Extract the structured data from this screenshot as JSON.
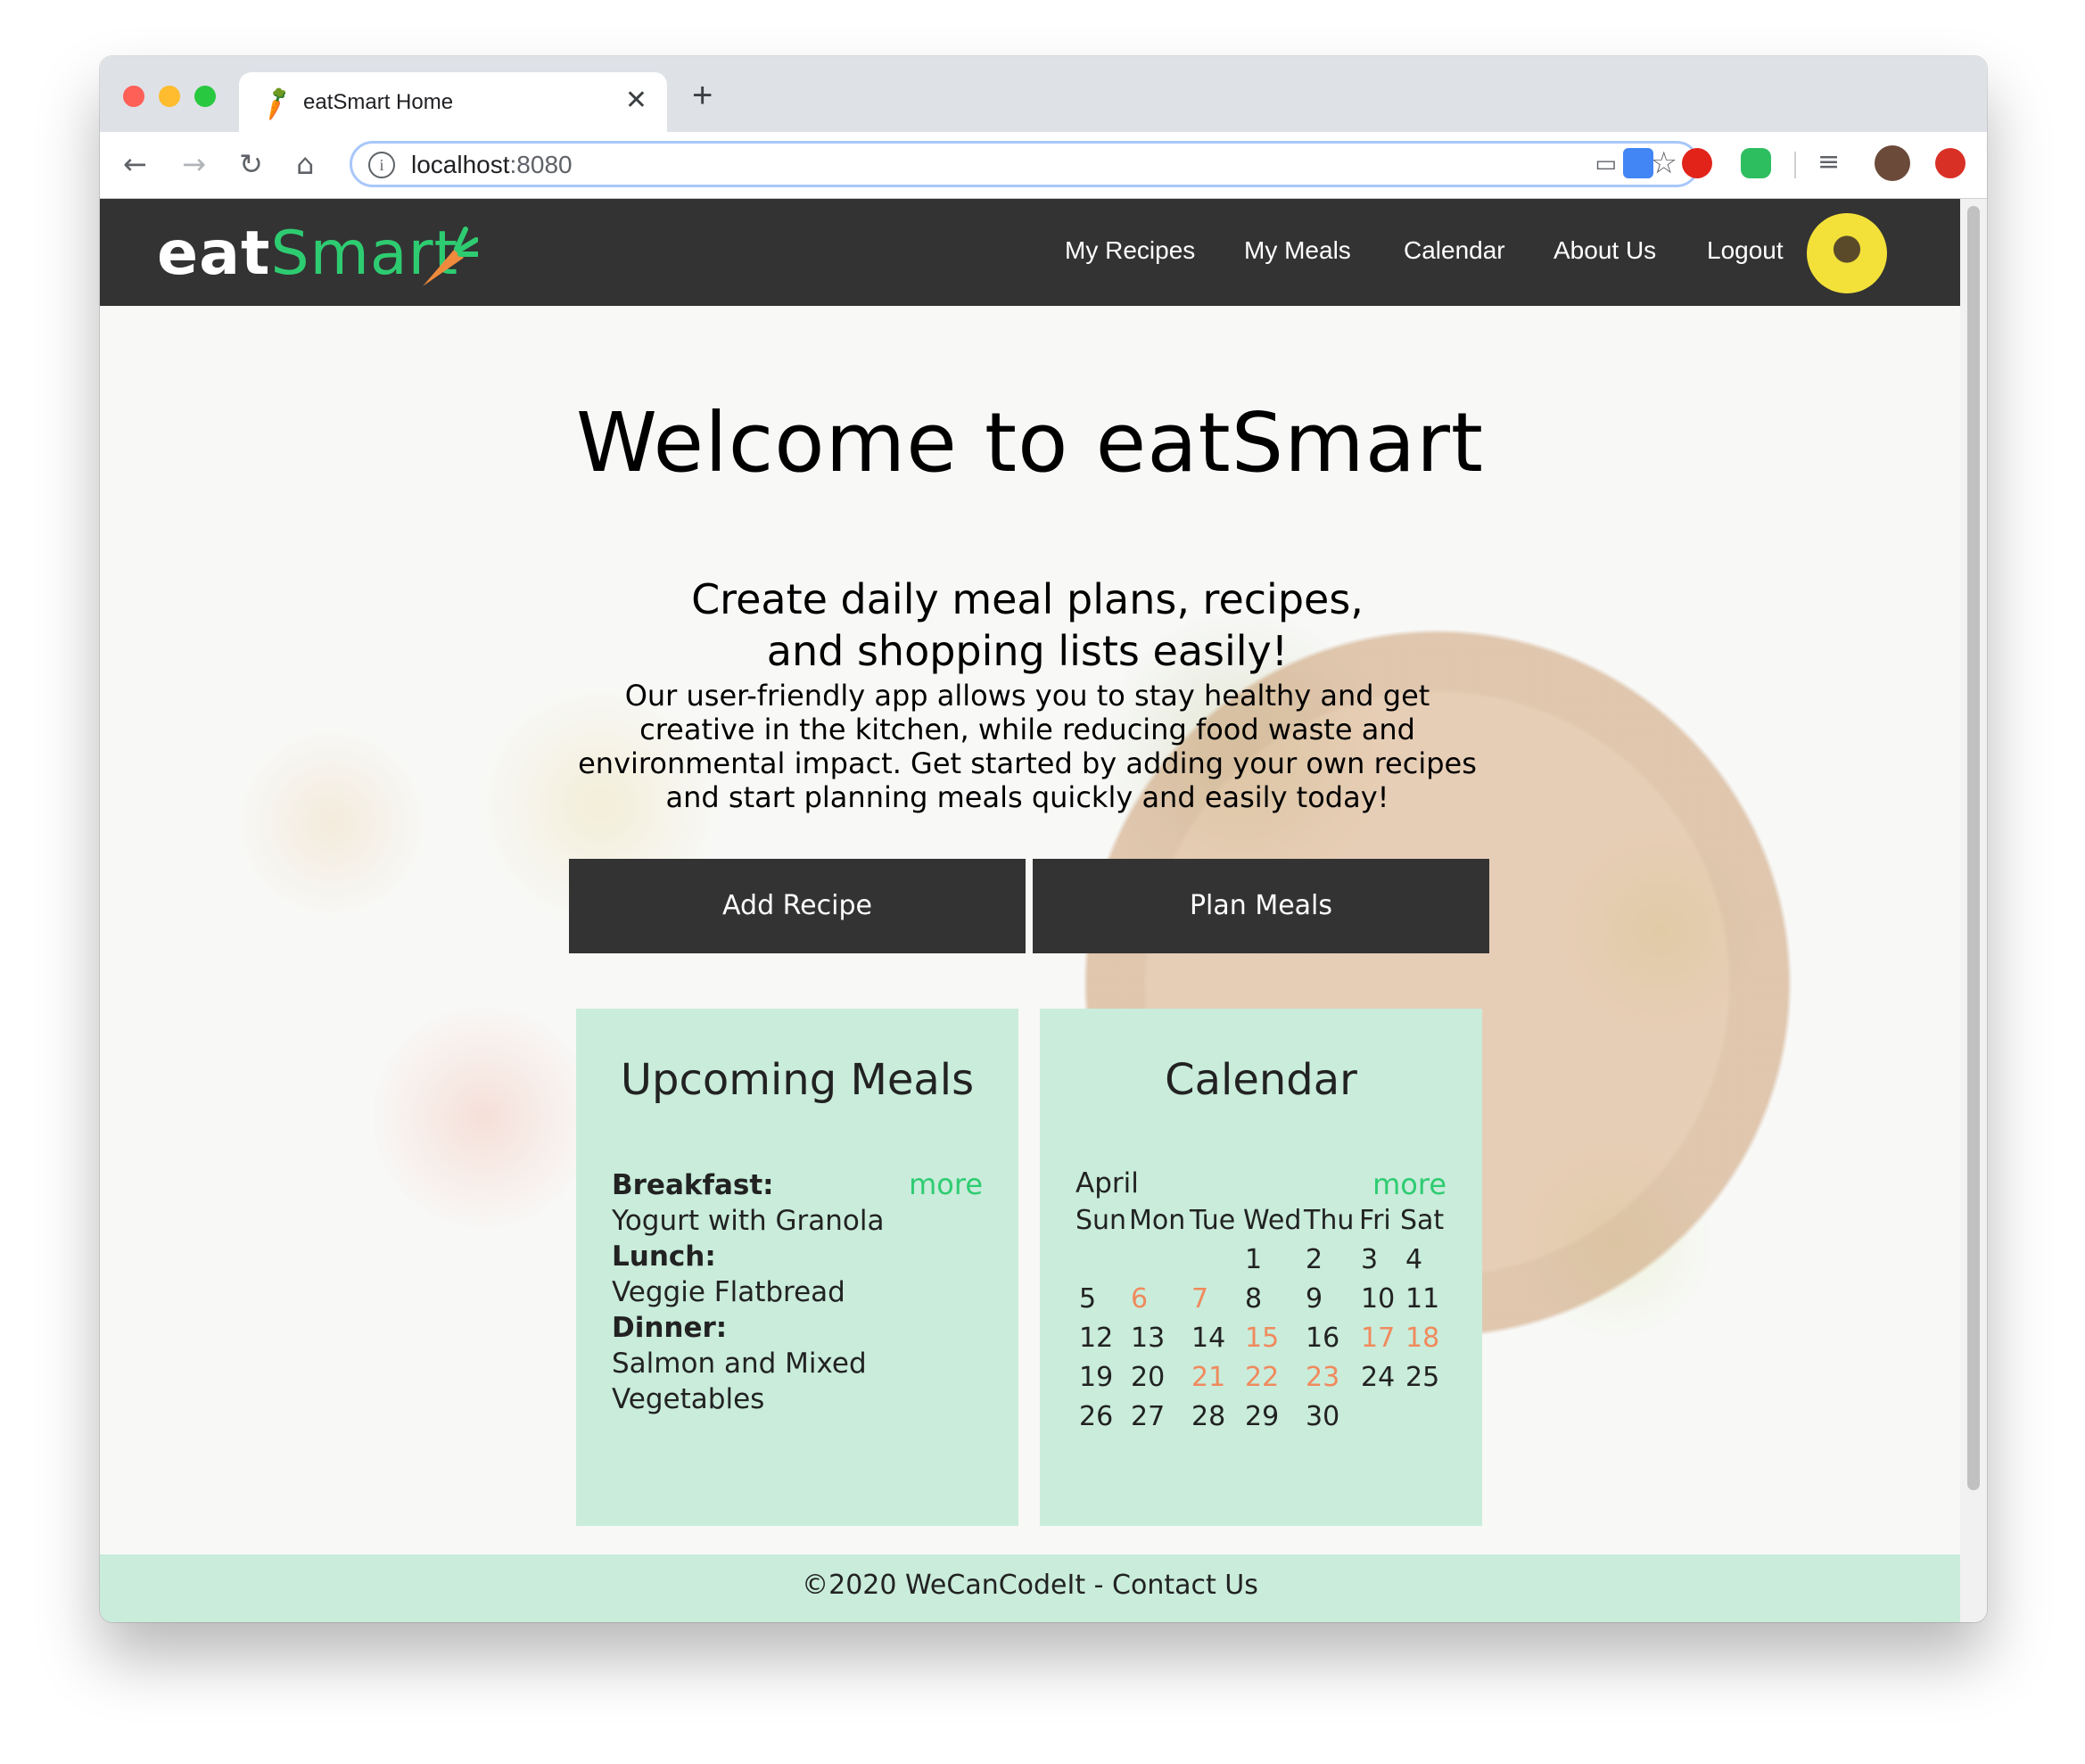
{
  "browser": {
    "tab_title": "eatSmart Home",
    "tab_close": "✕",
    "new_tab": "+",
    "url_host": "localhost",
    "url_port": ":8080"
  },
  "site": {
    "logo_eat": "eat",
    "logo_smart": "Smart",
    "nav": [
      "My Recipes",
      "My Meals",
      "Calendar",
      "About Us",
      "Logout"
    ]
  },
  "hero": {
    "title": "Welcome to eatSmart",
    "subtitle": "Create daily meal plans, recipes, and shopping lists easily!",
    "body": "Our user-friendly app allows you to stay healthy and get creative in the kitchen, while reducing food waste and environmental impact. Get started by adding your own recipes and start planning meals quickly and easily today!",
    "buttons": {
      "add_recipe": "Add Recipe",
      "plan_meals": "Plan Meals"
    }
  },
  "upcoming": {
    "title": "Upcoming Meals",
    "more": "more",
    "meals": [
      {
        "label": "Breakfast:",
        "value": "Yogurt with Granola"
      },
      {
        "label": "Lunch:",
        "value": "Veggie Flatbread"
      },
      {
        "label": "Dinner:",
        "value": "Salmon and Mixed Vegetables"
      }
    ]
  },
  "calendar": {
    "title": "Calendar",
    "more": "more",
    "month": "April",
    "weekdays": [
      "Sun",
      "Mon",
      "Tue",
      "Wed",
      "Thu",
      "Fri",
      "Sat"
    ],
    "weeks": [
      [
        "",
        "",
        "",
        "1",
        "2",
        "3",
        "4"
      ],
      [
        "5",
        "6",
        "7",
        "8",
        "9",
        "10",
        "11"
      ],
      [
        "12",
        "13",
        "14",
        "15",
        "16",
        "17",
        "18"
      ],
      [
        "19",
        "20",
        "21",
        "22",
        "23",
        "24",
        "25"
      ],
      [
        "26",
        "27",
        "28",
        "29",
        "30",
        "",
        ""
      ]
    ],
    "highlighted_days": [
      "6",
      "7",
      "15",
      "17",
      "18",
      "21",
      "22",
      "23"
    ],
    "highlight_color": "#f08a5d"
  },
  "footer": {
    "text": "©2020 WeCanCodeIt - Contact Us"
  },
  "colors": {
    "nav_bg": "#333333",
    "accent_green": "#2ecc71",
    "card_bg": "#c9ecdb"
  }
}
